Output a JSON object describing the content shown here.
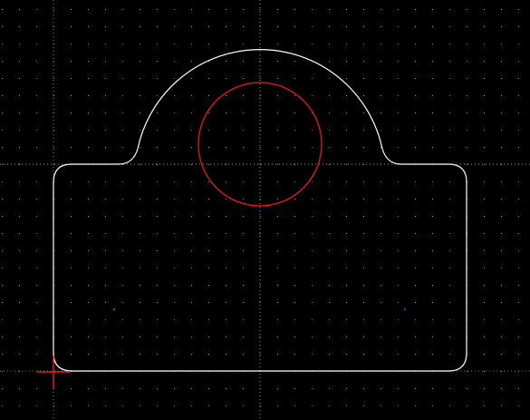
{
  "canvas": {
    "background_color": "#000000",
    "grid": {
      "visible": true,
      "dot_color": "#7a7a7a",
      "axis_line_color": "#9a9a9a",
      "axis_line_style": "dotted"
    },
    "outline": {
      "color": "#ffffff",
      "shape": "rounded-rectangle-with-semicircular-top-lobe"
    },
    "circle": {
      "color": "#ff1a1a",
      "style": "stroke"
    },
    "origin_marker": {
      "color": "#ff2020",
      "shape": "crosshair"
    },
    "markers": [
      {
        "name": "left-point-marker",
        "color": "#c000c0"
      },
      {
        "name": "right-point-marker",
        "color": "#3030ff"
      }
    ]
  }
}
